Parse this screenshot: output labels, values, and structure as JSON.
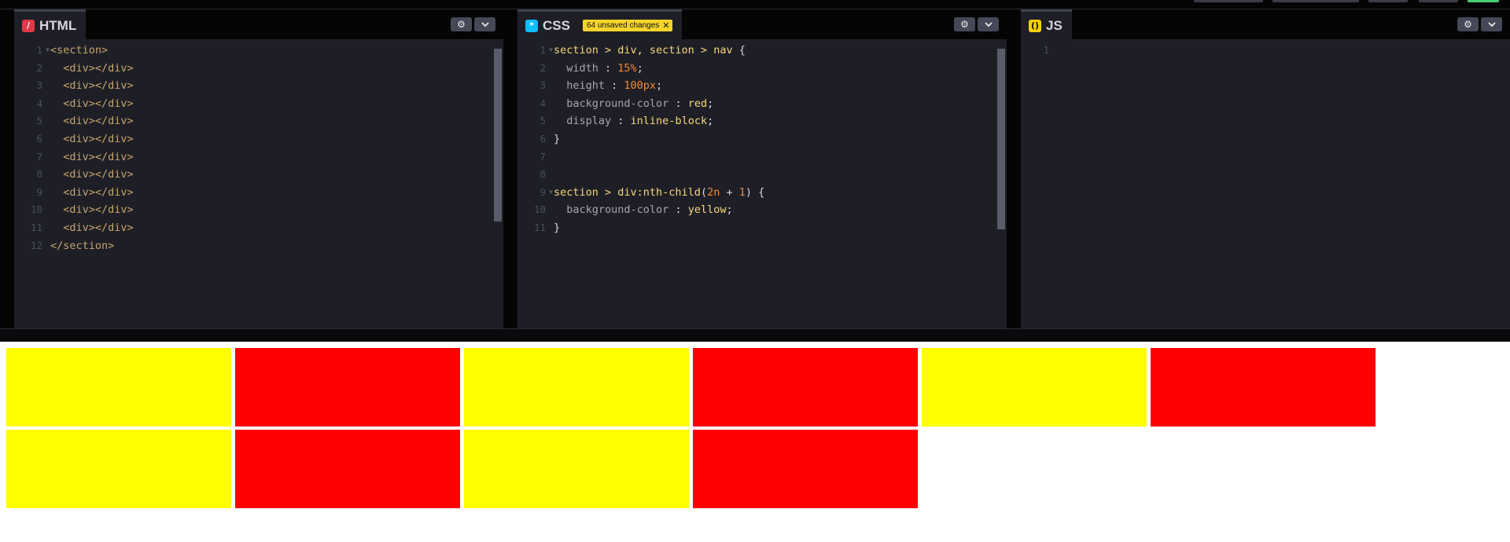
{
  "html_panel": {
    "title": "HTML",
    "icon": "html-icon",
    "lines": [
      {
        "n": "1",
        "fold": true,
        "text": "<section>"
      },
      {
        "n": "2",
        "text": "  <div></div>"
      },
      {
        "n": "3",
        "text": "  <div></div>"
      },
      {
        "n": "4",
        "text": "  <div></div>"
      },
      {
        "n": "5",
        "text": "  <div></div>"
      },
      {
        "n": "6",
        "text": "  <div></div>"
      },
      {
        "n": "7",
        "text": "  <div></div>"
      },
      {
        "n": "8",
        "text": "  <div></div>"
      },
      {
        "n": "9",
        "text": "  <div></div>"
      },
      {
        "n": "10",
        "text": "  <div></div>"
      },
      {
        "n": "11",
        "text": "  <div></div>"
      },
      {
        "n": "12",
        "text": "</section>"
      }
    ]
  },
  "css_panel": {
    "title": "CSS",
    "icon": "css-icon",
    "unsaved_badge": "64 unsaved changes",
    "lines": [
      {
        "n": "1",
        "fold": true,
        "tokens": [
          [
            "sel",
            "section > div, section > nav "
          ],
          [
            "pun",
            "{"
          ]
        ]
      },
      {
        "n": "2",
        "tokens": [
          [
            "prop",
            "  width "
          ],
          [
            "pun",
            ": "
          ],
          [
            "num",
            "15%"
          ],
          [
            "pun",
            ";"
          ]
        ]
      },
      {
        "n": "3",
        "tokens": [
          [
            "prop",
            "  height "
          ],
          [
            "pun",
            ": "
          ],
          [
            "num",
            "100px"
          ],
          [
            "pun",
            ";"
          ]
        ]
      },
      {
        "n": "4",
        "tokens": [
          [
            "prop",
            "  background-color "
          ],
          [
            "pun",
            ": "
          ],
          [
            "val",
            "red"
          ],
          [
            "pun",
            ";"
          ]
        ]
      },
      {
        "n": "5",
        "tokens": [
          [
            "prop",
            "  display "
          ],
          [
            "pun",
            ": "
          ],
          [
            "val",
            "inline-block"
          ],
          [
            "pun",
            ";"
          ]
        ]
      },
      {
        "n": "6",
        "tokens": [
          [
            "pun",
            "}"
          ]
        ]
      },
      {
        "n": "7",
        "tokens": []
      },
      {
        "n": "8",
        "tokens": []
      },
      {
        "n": "9",
        "fold": true,
        "tokens": [
          [
            "sel",
            "section > div:nth-child"
          ],
          [
            "pun",
            "("
          ],
          [
            "num",
            "2n"
          ],
          [
            "pun",
            " + "
          ],
          [
            "num",
            "1"
          ],
          [
            "pun",
            ") {"
          ]
        ]
      },
      {
        "n": "10",
        "tokens": [
          [
            "prop",
            "  background-color "
          ],
          [
            "pun",
            ": "
          ],
          [
            "val",
            "yellow"
          ],
          [
            "pun",
            ";"
          ]
        ]
      },
      {
        "n": "11",
        "tokens": [
          [
            "pun",
            "}"
          ]
        ]
      }
    ]
  },
  "js_panel": {
    "title": "JS",
    "icon": "js-icon",
    "lines": [
      {
        "n": "1",
        "text": ""
      }
    ]
  },
  "panel_buttons": {
    "settings_icon": "gear-icon",
    "menu_icon": "chevron-down-icon"
  },
  "preview": {
    "boxes": [
      "yellow",
      "red",
      "yellow",
      "red",
      "yellow",
      "red",
      "yellow",
      "red",
      "yellow",
      "red"
    ]
  },
  "colors": {
    "yellow": "#ffff00",
    "red": "#ff0000",
    "badge": "#f5d52a",
    "editor_bg": "#1e1f26"
  }
}
